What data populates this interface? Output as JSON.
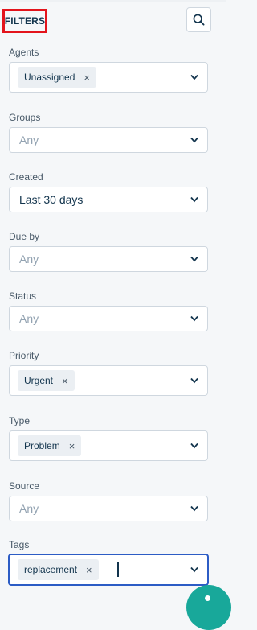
{
  "panel": {
    "title": "FILTERS",
    "search_icon": "search-icon"
  },
  "filters": {
    "agents": {
      "label": "Agents",
      "chips": [
        "Unassigned"
      ]
    },
    "groups": {
      "label": "Groups",
      "placeholder": "Any"
    },
    "created": {
      "label": "Created",
      "value": "Last 30 days"
    },
    "due_by": {
      "label": "Due by",
      "placeholder": "Any"
    },
    "status": {
      "label": "Status",
      "placeholder": "Any"
    },
    "priority": {
      "label": "Priority",
      "chips": [
        "Urgent"
      ]
    },
    "type": {
      "label": "Type",
      "chips": [
        "Problem"
      ]
    },
    "source": {
      "label": "Source",
      "placeholder": "Any"
    },
    "tags": {
      "label": "Tags",
      "chips": [
        "replacement"
      ]
    }
  },
  "chip_remove_glyph": "×",
  "colors": {
    "accent": "#2c5cc5",
    "highlight_border": "#e3141c",
    "fab": "#18a89a"
  }
}
